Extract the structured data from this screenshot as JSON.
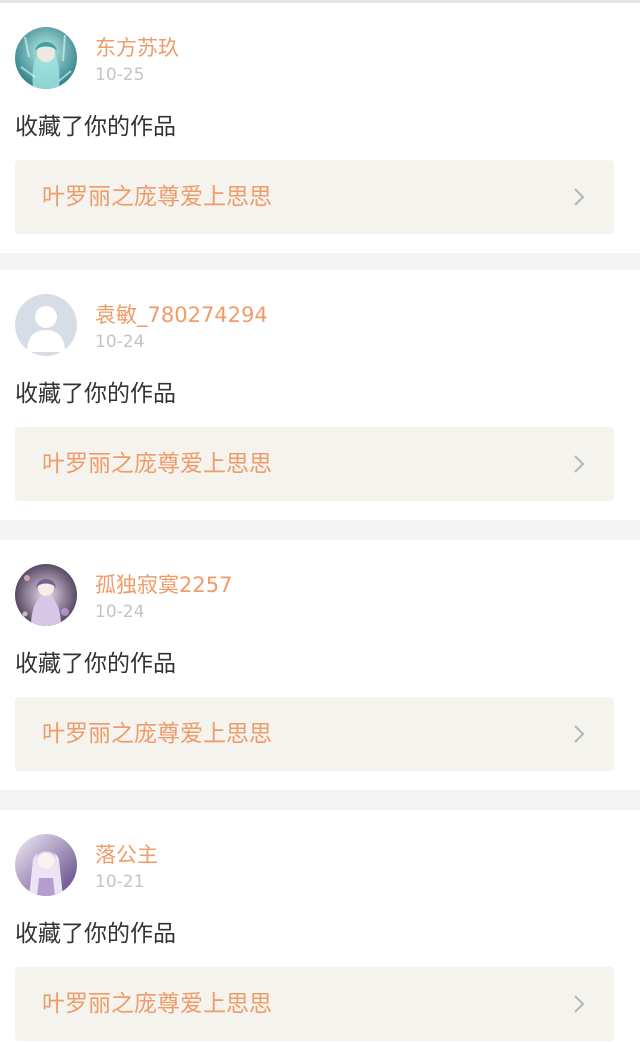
{
  "notifications": [
    {
      "username": "东方苏玖",
      "date": "10-25",
      "action": "收藏了你的作品",
      "work_title": "叶罗丽之庞尊爱上思思",
      "avatar_icon": "anime-avatar-teal-icon",
      "colors": {
        "avatar_bg": "#2f7d86",
        "avatar_accent": "#9fe3e0"
      }
    },
    {
      "username": "袁敏_780274294",
      "date": "10-24",
      "action": "收藏了你的作品",
      "work_title": "叶罗丽之庞尊爱上思思",
      "avatar_icon": "default-user-silhouette-icon",
      "colors": {
        "avatar_bg": "#d7dde6",
        "avatar_accent": "#ffffff"
      }
    },
    {
      "username": "孤独寂寞2257",
      "date": "10-24",
      "action": "收藏了你的作品",
      "work_title": "叶罗丽之庞尊爱上思思",
      "avatar_icon": "anime-avatar-purple-dark-icon",
      "colors": {
        "avatar_bg": "#4a3a55",
        "avatar_accent": "#d8c6e6"
      }
    },
    {
      "username": "落公主",
      "date": "10-21",
      "action": "收藏了你的作品",
      "work_title": "叶罗丽之庞尊爱上思思",
      "avatar_icon": "anime-avatar-lavender-icon",
      "colors": {
        "avatar_bg": "#6b4f8f",
        "avatar_accent": "#ece4f5"
      }
    }
  ],
  "theme": {
    "accent": "#ef9c6a",
    "date_color": "#c4c4c4",
    "text_color": "#333333",
    "link_bg": "#f4f3ee",
    "page_bg": "#f4f4f4",
    "chevron_color": "#b8b8b8"
  }
}
